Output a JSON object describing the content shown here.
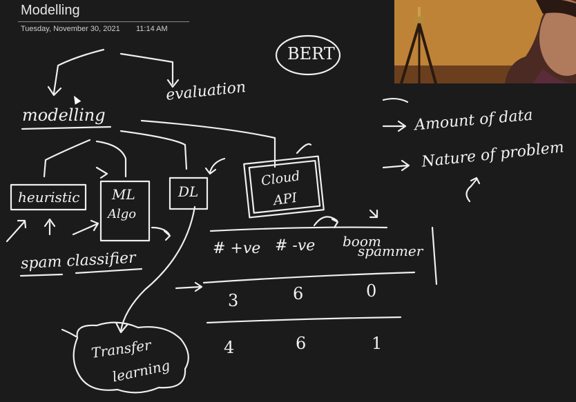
{
  "page": {
    "title": "Modelling",
    "date": "Tuesday, November 30, 2021",
    "time": "11:14 AM"
  },
  "ink": {
    "bert": "BERT",
    "modelling": "modelling",
    "evaluation": "evaluation",
    "heuristic": "heuristic",
    "ml_algo_line1": "ML",
    "ml_algo_line2": "Algo",
    "dl": "DL",
    "cloud_api_line1": "Cloud",
    "cloud_api_line2": "API",
    "amount_of_data": "Amount of data",
    "nature_of_problem": "Nature of problem",
    "spam_classifier": "spam classifier",
    "transfer_line1": "Transfer",
    "transfer_line2": "learning",
    "table": {
      "headers": [
        "# +ve",
        "# -ve",
        "boom",
        "spammer"
      ],
      "rows": [
        [
          "3",
          "6",
          "0"
        ],
        [
          "4",
          "6",
          "1"
        ]
      ]
    }
  },
  "webcam": {
    "icon": "webcam-feed"
  }
}
